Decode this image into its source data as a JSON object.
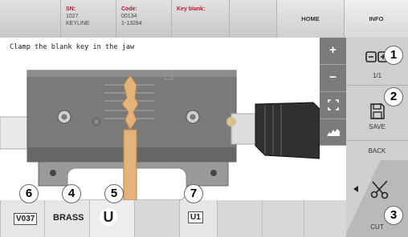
{
  "header": {
    "sn_label": "SN:",
    "sn_value_1": "1027",
    "sn_value_2": "KEYLINE",
    "code_label": "Code:",
    "code_value_1": "00134",
    "code_value_2": "1-13284",
    "key_blank_label": "Key blank:",
    "home_label": "HOME",
    "info_label": "INFO"
  },
  "message": "Clamp the blank key in the jaw",
  "view_tools": {
    "zoom_in": "+",
    "zoom_out": "−"
  },
  "right_panel": {
    "page_indicator": "1/1",
    "save_label": "SAVE",
    "back_label": "BACK",
    "cut_label": "CUT"
  },
  "callouts": [
    "1",
    "2",
    "3",
    "4",
    "5",
    "6",
    "7"
  ],
  "bottom_bar": {
    "profile_code": "V037",
    "material": "BRASS",
    "clamp_letter": "U",
    "clamp_position": "U1"
  },
  "colors": {
    "jaw_body": "#7a7a7a",
    "key_blank": "#e3b37a",
    "handle": "#303030",
    "callout_border": "#333333"
  }
}
